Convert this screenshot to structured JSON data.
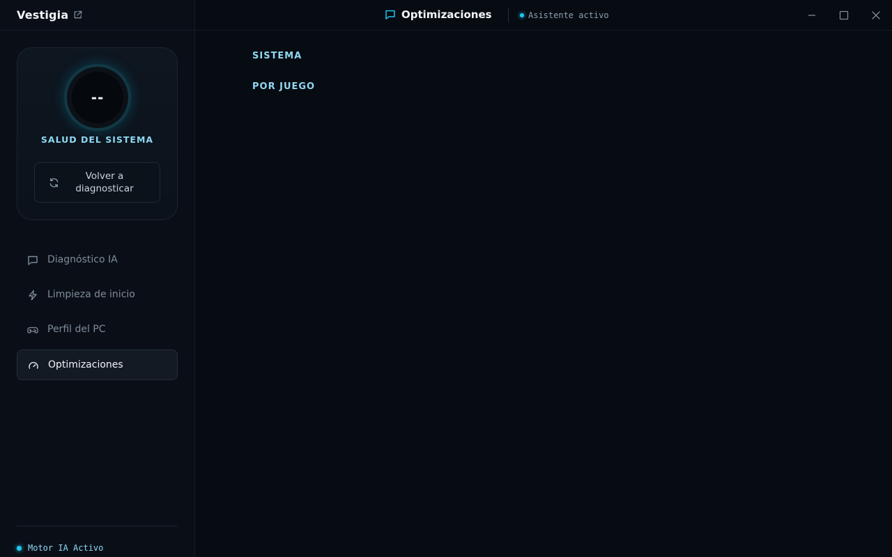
{
  "app": {
    "name": "Vestigia"
  },
  "header": {
    "title": "Optimizaciones",
    "assistant_status": "Asistente activo"
  },
  "health": {
    "score": "--",
    "label": "SALUD DEL SISTEMA",
    "rediagnose_line1": "Volver a",
    "rediagnose_line2": "diagnosticar"
  },
  "sidebar": {
    "items": [
      {
        "label": "Diagnóstico IA",
        "icon": "chat-icon",
        "active": false
      },
      {
        "label": "Limpieza de inicio",
        "icon": "lightning-icon",
        "active": false
      },
      {
        "label": "Perfil del PC",
        "icon": "gamepad-icon",
        "active": false
      },
      {
        "label": "Optimizaciones",
        "icon": "gauge-icon",
        "active": true
      }
    ],
    "engine_status": "Motor IA Activo"
  },
  "main": {
    "sections": [
      {
        "label": "SISTEMA"
      },
      {
        "label": "POR JUEGO"
      }
    ]
  },
  "colors": {
    "accent": "#1fc7ee",
    "accent_text": "#8fd8f2",
    "background": "#070b12"
  }
}
